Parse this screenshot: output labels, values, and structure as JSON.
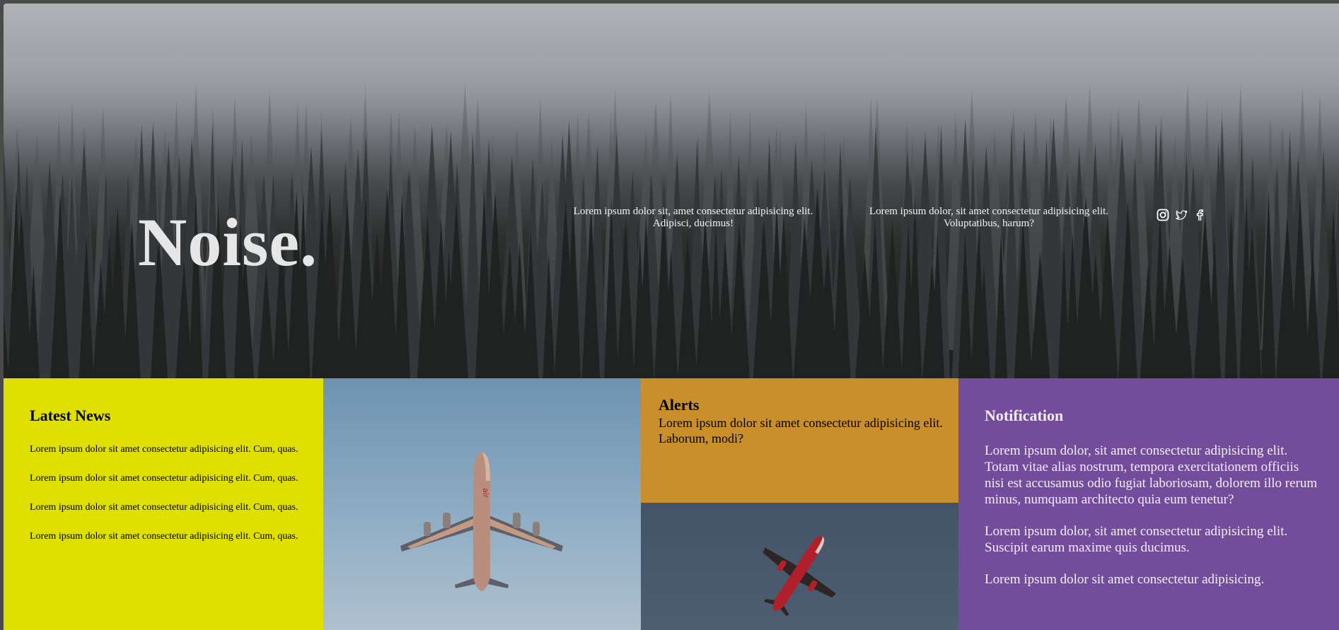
{
  "hero": {
    "brand": "Noise.",
    "text_one": "Lorem ipsum dolor sit, amet consectetur adipisicing elit. Adipisci, ducimus!",
    "text_two": "Lorem ipsum dolor, sit amet consectetur adipisicing elit. Voluptatibus, harum?",
    "social": [
      "instagram-icon",
      "twitter-icon",
      "facebook-icon"
    ]
  },
  "news": {
    "title": "Latest News",
    "items": [
      "Lorem ipsum dolor sit amet consectetur adipisicing elit. Cum, quas.",
      "Lorem ipsum dolor sit amet consectetur adipisicing elit. Cum, quas.",
      "Lorem ipsum dolor sit amet consectetur adipisicing elit. Cum, quas.",
      "Lorem ipsum dolor sit amet consectetur adipisicing elit. Cum, quas."
    ]
  },
  "alerts": {
    "title": "Alerts",
    "text": "Lorem ipsum dolor sit amet consectetur adipisicing elit. Laborum, modi?"
  },
  "notification": {
    "title": "Notification",
    "paragraphs": [
      "Lorem ipsum dolor, sit amet consectetur adipisicing elit. Totam vitae alias nostrum, tempora exercitationem officiis nisi est accusamus odio fugiat laboriosam, dolorem illo rerum minus, numquam architecto quia eum tenetur?",
      "Lorem ipsum dolor, sit amet consectetur adipisicing elit. Suscipit earum maxime quis ducimus.",
      "Lorem ipsum dolor sit amet consectetur adipisicing."
    ]
  },
  "colors": {
    "news_bg": "#dfdf00",
    "alerts_bg": "#c98f2b",
    "notification_bg": "#744c9c"
  }
}
